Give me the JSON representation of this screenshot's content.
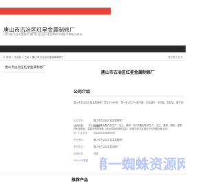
{
  "banner": {
    "text": "U型卡箍,古冶/红星锚杆,道钉机,岩石钻,U型支撑钢,手撑锚,手撑枪子"
  },
  "header": {
    "site_title": "唐山市古冶区红星金属制修厂",
    "site_subtitle": "U型卡箍,古冶/红星锚杆,道钉机,岩石钻,U型支撑钢,手撑锚,手撑枪子(修利)"
  },
  "breadcrumb": {
    "home": "首页",
    "sep1": "古冶区",
    "sep2": "古冶",
    "current": "唐山市古冶区红星金属制修厂",
    "cert": "更多服务咨询"
  },
  "sidebar": {
    "title": "唐山市古冶区红星金属制修厂"
  },
  "company": {
    "title": "唐山市古冶区红星金属制修厂",
    "section_heading": "公司介绍",
    "intro": "唐山市古冶区红星金属制修厂成立于1989年，是一家以生产U型卡箍、古冶锚杆、手撑锚、岩石钻、道钉机等为主的企业。",
    "rows": [
      {
        "k": "企业名称：",
        "v": "唐山市古冶区红星金属制修厂"
      },
      {
        "k": "法人代表：",
        "v": "冯建彬"
      },
      {
        "k": "统一社会信用：",
        "v": "9113020419880405T"
      },
      {
        "k": "所在地址：",
        "v": "唐山市古冶区红星金属制修厂"
      },
      {
        "k": "联系电话：",
        "v": "唐山市古冶区金属制修厂"
      },
      {
        "k": "经营状态：",
        "v": "存续"
      }
    ],
    "scope_label": "经营范围：",
    "scope": "矿山机械设备及配件的生产、加工、维修；电气设备及配件生产、加工、维修；钢铁、金属材料及制品、建筑材料的销售（依法须经批准的项目，经相关部门批准后方可开展经营活动）",
    "notice": "2014人气数量"
  },
  "footer": {
    "heading": "推荐产品"
  },
  "watermark": {
    "text": "第一蜘蛛资源网",
    "color": "#7d9bff"
  }
}
